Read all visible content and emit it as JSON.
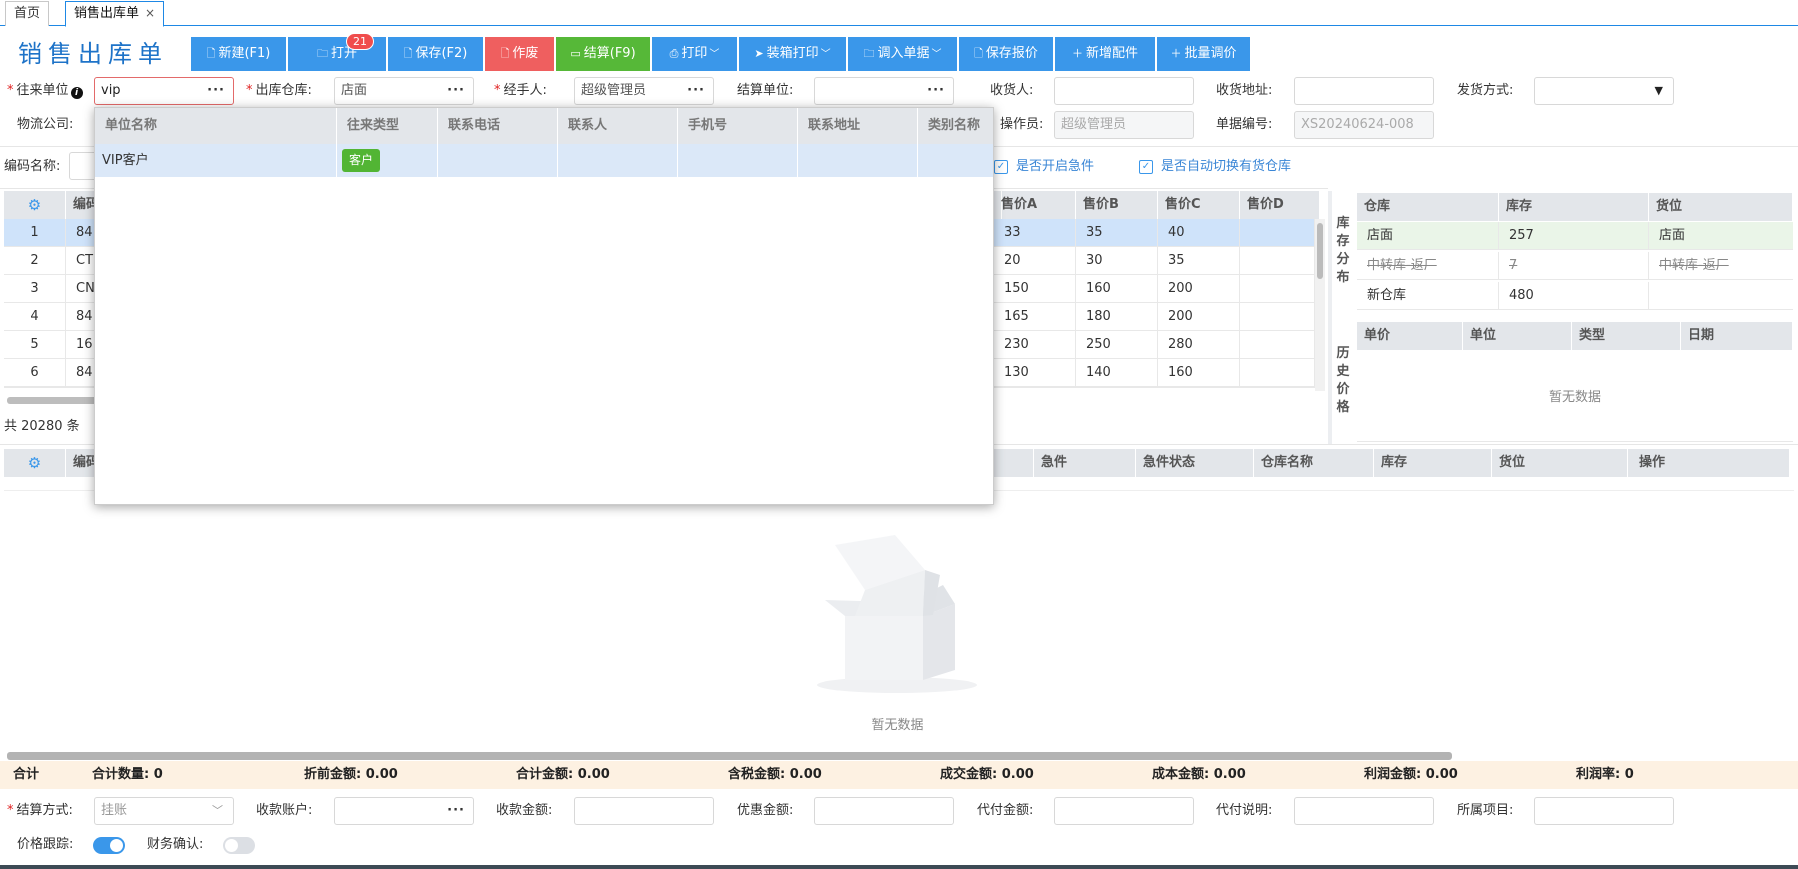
{
  "tabs": [
    {
      "label": "首页"
    },
    {
      "label": "销售出库单",
      "close": "×"
    }
  ],
  "page_title": "销售出库单",
  "toolbar": {
    "new": "新建(F1)",
    "open": "打开",
    "open_badge": "21",
    "save": "保存(F2)",
    "void": "作废",
    "settle": "结算(F9)",
    "print": "打印",
    "box_print": "装箱打印",
    "import": "调入单据",
    "save_quote": "保存报价",
    "add_part": "新增配件",
    "batch_price": "批量调价"
  },
  "form": {
    "partner_label": "往来单位",
    "partner_value": "vip",
    "warehouse_label": "出库仓库:",
    "warehouse_value": "店面",
    "handler_label": "经手人:",
    "handler_value": "超级管理员",
    "settle_unit_label": "结算单位:",
    "settle_unit_value": "",
    "receiver_label": "收货人:",
    "receiver_value": "",
    "address_label": "收货地址:",
    "address_value": "",
    "ship_label": "发货方式:",
    "ship_value": "",
    "logistics_label": "物流公司:",
    "operator_label": "操作员:",
    "operator_value": "超级管理员",
    "docno_label": "单据编号:",
    "docno_value": "XS20240624-008",
    "code_label": "编码名称:",
    "urgent_label": "是否开启急件",
    "auto_switch_label": "是否自动切换有货仓库"
  },
  "dropdown": {
    "headers": [
      "单位名称",
      "往来类型",
      "联系电话",
      "联系人",
      "手机号",
      "联系地址",
      "类别名称"
    ],
    "rows": [
      {
        "name": "VIP客户",
        "type": "客户"
      }
    ]
  },
  "product_grid": {
    "headers": [
      "编码",
      "售价A",
      "售价B",
      "售价C",
      "售价D"
    ],
    "rows": [
      {
        "no": "1",
        "code": "84",
        "a": "33",
        "b": "35",
        "c": "40"
      },
      {
        "no": "2",
        "code": "CT",
        "a": "20",
        "b": "30",
        "c": "35"
      },
      {
        "no": "3",
        "code": "CN",
        "a": "150",
        "b": "160",
        "c": "200"
      },
      {
        "no": "4",
        "code": "84",
        "a": "165",
        "b": "180",
        "c": "200"
      },
      {
        "no": "5",
        "code": "16",
        "a": "230",
        "b": "250",
        "c": "280"
      },
      {
        "no": "6",
        "code": "84",
        "a": "130",
        "b": "140",
        "c": "160"
      }
    ],
    "total_text": "共 20280 条"
  },
  "stock_panel": {
    "title": "库存分布",
    "headers": [
      "仓库",
      "库存",
      "货位"
    ],
    "rows": [
      {
        "wh": "店面",
        "qty": "257",
        "loc": "店面"
      },
      {
        "wh": "中转库-返厂",
        "qty": "7",
        "loc": "中转库-返厂"
      },
      {
        "wh": "新仓库",
        "qty": "480",
        "loc": ""
      }
    ]
  },
  "history_panel": {
    "title": "历史价格",
    "headers": [
      "单价",
      "单位",
      "类型",
      "日期"
    ],
    "empty": "暂无数据"
  },
  "detail_grid": {
    "headers": [
      "编码",
      "急件",
      "急件状态",
      "仓库名称",
      "库存",
      "货位",
      "操作"
    ],
    "empty": "暂无数据"
  },
  "totals": {
    "label": "合计",
    "qty": "合计数量: 0",
    "pre_discount": "折前金额: 0.00",
    "sum": "合计金额: 0.00",
    "tax": "含税金额: 0.00",
    "deal": "成交金额: 0.00",
    "cost": "成本金额: 0.00",
    "profit": "利润金额: 0.00",
    "margin": "利润率: 0"
  },
  "bottom": {
    "settle_method_label": "结算方式:",
    "settle_method_value": "挂账",
    "account_label": "收款账户:",
    "receive_label": "收款金额:",
    "discount_label": "优惠金额:",
    "agent_label": "代付金额:",
    "agent_desc_label": "代付说明:",
    "project_label": "所属项目:",
    "price_track_label": "价格跟踪:",
    "finance_label": "财务确认:"
  },
  "colors": {
    "accent": "#3a97ea",
    "danger": "#ef5f5f",
    "success": "#56b838"
  }
}
